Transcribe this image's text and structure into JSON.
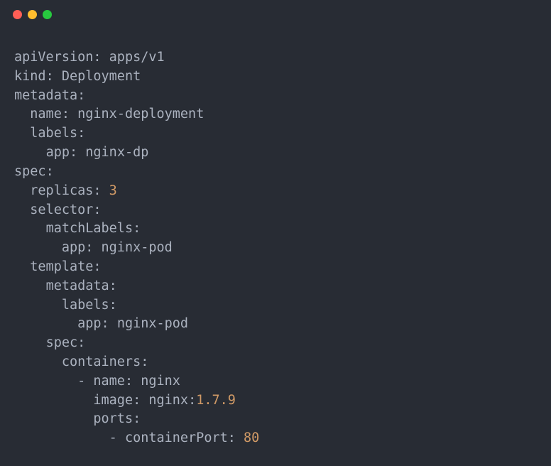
{
  "window": {
    "traffic_lights": {
      "close": "close",
      "minimize": "minimize",
      "maximize": "maximize"
    }
  },
  "code": {
    "l1_key": "apiVersion",
    "l1_val": "apps/v1",
    "l2_key": "kind",
    "l2_val": "Deployment",
    "l3_key": "metadata",
    "l4_key": "name",
    "l4_val": "nginx-deployment",
    "l5_key": "labels",
    "l6_key": "app",
    "l6_val": "nginx-dp",
    "l7_key": "spec",
    "l8_key": "replicas",
    "l8_val": "3",
    "l9_key": "selector",
    "l10_key": "matchLabels",
    "l11_key": "app",
    "l11_val": "nginx-pod",
    "l12_key": "template",
    "l13_key": "metadata",
    "l14_key": "labels",
    "l15_key": "app",
    "l15_val": "nginx-pod",
    "l16_key": "spec",
    "l17_key": "containers",
    "l18_dash": "-",
    "l18_key": "name",
    "l18_val": "nginx",
    "l19_key": "image",
    "l19_val_name": "nginx",
    "l19_val_tag": "1.7.9",
    "l20_key": "ports",
    "l21_dash": "-",
    "l21_key": "containerPort",
    "l21_val": "80"
  }
}
